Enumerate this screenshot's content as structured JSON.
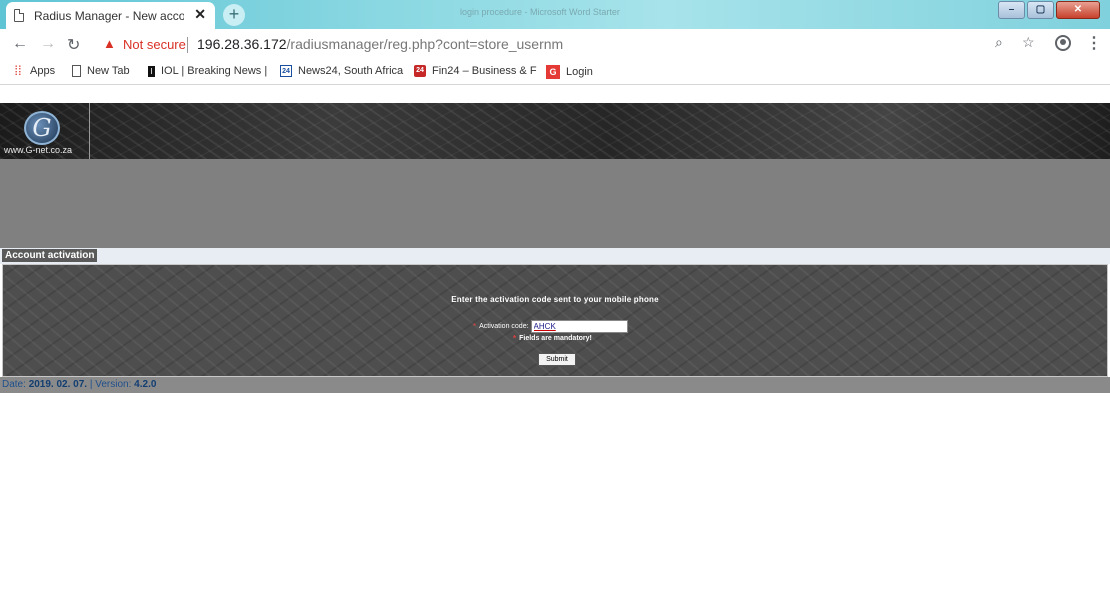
{
  "browser": {
    "tab_title": "Radius Manager - New account r",
    "tab_close": "✕",
    "new_tab": "+",
    "window_title": "login procedure - Microsoft Word Starter",
    "security_label": "Not secure",
    "url_host": "196.28.36.172",
    "url_path": "/radiusmanager/reg.php?cont=store_usernm"
  },
  "bookmarks": [
    {
      "label": "Apps",
      "icon": "apps-icon"
    },
    {
      "label": "New Tab",
      "icon": "page-icon"
    },
    {
      "label": "IOL | Breaking News |",
      "icon": "iol-icon"
    },
    {
      "label": "News24, South Africa",
      "icon": "news24-icon"
    },
    {
      "label": "Fin24 – Business & F",
      "icon": "fin24-icon"
    },
    {
      "label": "Login",
      "icon": "ig-icon"
    }
  ],
  "header": {
    "logo_text": "www.G-net.co.za",
    "logo_glyph": "G"
  },
  "section": {
    "title": "Account activation"
  },
  "form": {
    "heading": "Enter the activation code sent to your mobile phone",
    "code_label": "Activation code:",
    "code_value": "AHCK",
    "required_mark": "*",
    "mandatory_note": "Fields are mandatory!",
    "submit_label": "Submit"
  },
  "footer": {
    "date_label": "Date:",
    "date_value": "2019. 02. 07.",
    "separator": "|",
    "version_label": "Version:",
    "version_value": "4.2.0"
  },
  "colors": {
    "tab_bar": "#5fc4d4",
    "insecure": "#d93025",
    "panel": "#4e4e4e",
    "grey_band": "#808080",
    "footer_text": "#1f4f8a"
  }
}
